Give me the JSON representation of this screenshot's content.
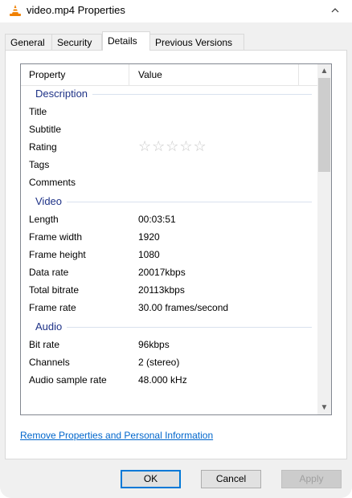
{
  "window": {
    "title": "video.mp4 Properties"
  },
  "tabs": [
    {
      "label": "General"
    },
    {
      "label": "Security"
    },
    {
      "label": "Details"
    },
    {
      "label": "Previous Versions"
    }
  ],
  "list": {
    "header": {
      "property": "Property",
      "value": "Value"
    },
    "groups": {
      "description": "Description",
      "video": "Video",
      "audio": "Audio"
    },
    "description_rows": [
      {
        "k": "Title",
        "v": ""
      },
      {
        "k": "Subtitle",
        "v": ""
      },
      {
        "k": "Rating",
        "v": ""
      },
      {
        "k": "Tags",
        "v": ""
      },
      {
        "k": "Comments",
        "v": ""
      }
    ],
    "rating_stars": "☆☆☆☆☆",
    "video_rows": [
      {
        "k": "Length",
        "v": "00:03:51"
      },
      {
        "k": "Frame width",
        "v": "1920"
      },
      {
        "k": "Frame height",
        "v": "1080"
      },
      {
        "k": "Data rate",
        "v": "20017kbps"
      },
      {
        "k": "Total bitrate",
        "v": "20113kbps"
      },
      {
        "k": "Frame rate",
        "v": "30.00 frames/second"
      }
    ],
    "audio_rows": [
      {
        "k": "Bit rate",
        "v": "96kbps"
      },
      {
        "k": "Channels",
        "v": "2 (stereo)"
      },
      {
        "k": "Audio sample rate",
        "v": "48.000 kHz"
      }
    ]
  },
  "remove_link": "Remove Properties and Personal Information",
  "buttons": {
    "ok": "OK",
    "cancel": "Cancel",
    "apply": "Apply"
  },
  "colors": {
    "group_heading": "#1e3287",
    "link": "#0066cc",
    "accent": "#0078d7"
  },
  "icons": {
    "app": "vlc-cone-icon",
    "collapse": "chevron-up-icon",
    "scroll_up": "chevron-up-icon",
    "scroll_down": "chevron-down-icon"
  }
}
